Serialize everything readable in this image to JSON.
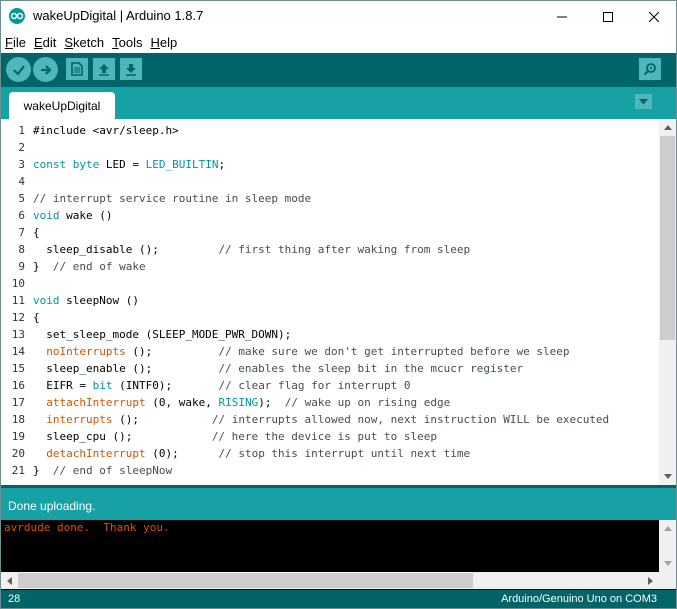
{
  "window": {
    "title": "wakeUpDigital | Arduino 1.8.7"
  },
  "menu": {
    "items": [
      {
        "key": "F",
        "rest": "ile"
      },
      {
        "key": "E",
        "rest": "dit"
      },
      {
        "key": "S",
        "rest": "ketch"
      },
      {
        "key": "T",
        "rest": "ools"
      },
      {
        "key": "H",
        "rest": "elp"
      }
    ]
  },
  "toolbar": {
    "icons": [
      "verify-icon",
      "upload-icon",
      "new-icon",
      "open-icon",
      "save-icon",
      "serial-monitor-icon"
    ]
  },
  "tabs": [
    {
      "label": "wakeUpDigital",
      "active": true
    }
  ],
  "editor": {
    "lines": [
      {
        "num": "1",
        "code": "#include <avr/sleep.h>"
      },
      {
        "num": "2",
        "code": ""
      },
      {
        "num": "3",
        "code": "const byte LED = LED_BUILTIN;"
      },
      {
        "num": "4",
        "code": ""
      },
      {
        "num": "5",
        "code": "// interrupt service routine in sleep mode"
      },
      {
        "num": "6",
        "code": "void wake ()"
      },
      {
        "num": "7",
        "code": "{"
      },
      {
        "num": "8",
        "code": "  sleep_disable ();         // first thing after waking from sleep"
      },
      {
        "num": "9",
        "code": "}  // end of wake"
      },
      {
        "num": "10",
        "code": ""
      },
      {
        "num": "11",
        "code": "void sleepNow ()"
      },
      {
        "num": "12",
        "code": "{"
      },
      {
        "num": "13",
        "code": "  set_sleep_mode (SLEEP_MODE_PWR_DOWN);"
      },
      {
        "num": "14",
        "code": "  noInterrupts ();          // make sure we don't get interrupted before we sleep"
      },
      {
        "num": "15",
        "code": "  sleep_enable ();          // enables the sleep bit in the mcucr register"
      },
      {
        "num": "16",
        "code": "  EIFR = bit (INTF0);       // clear flag for interrupt 0"
      },
      {
        "num": "17",
        "code": "  attachInterrupt (0, wake, RISING);  // wake up on rising edge"
      },
      {
        "num": "18",
        "code": "  interrupts ();           // interrupts allowed now, next instruction WILL be executed"
      },
      {
        "num": "19",
        "code": "  sleep_cpu ();            // here the device is put to sleep"
      },
      {
        "num": "20",
        "code": "  detachInterrupt (0);      // stop this interrupt until next time"
      },
      {
        "num": "21",
        "code": "}  // end of sleepNow"
      }
    ]
  },
  "status": {
    "message": "Done uploading."
  },
  "console": {
    "text": "avrdude done.  Thank you."
  },
  "bottom": {
    "line_number": "28",
    "board": "Arduino/Genuino Uno on COM3"
  },
  "colors": {
    "teal_dark": "#006468",
    "teal_mid": "#17a1a5",
    "keyword": "#00979c",
    "function": "#d35400",
    "console_text": "#e34c00"
  }
}
